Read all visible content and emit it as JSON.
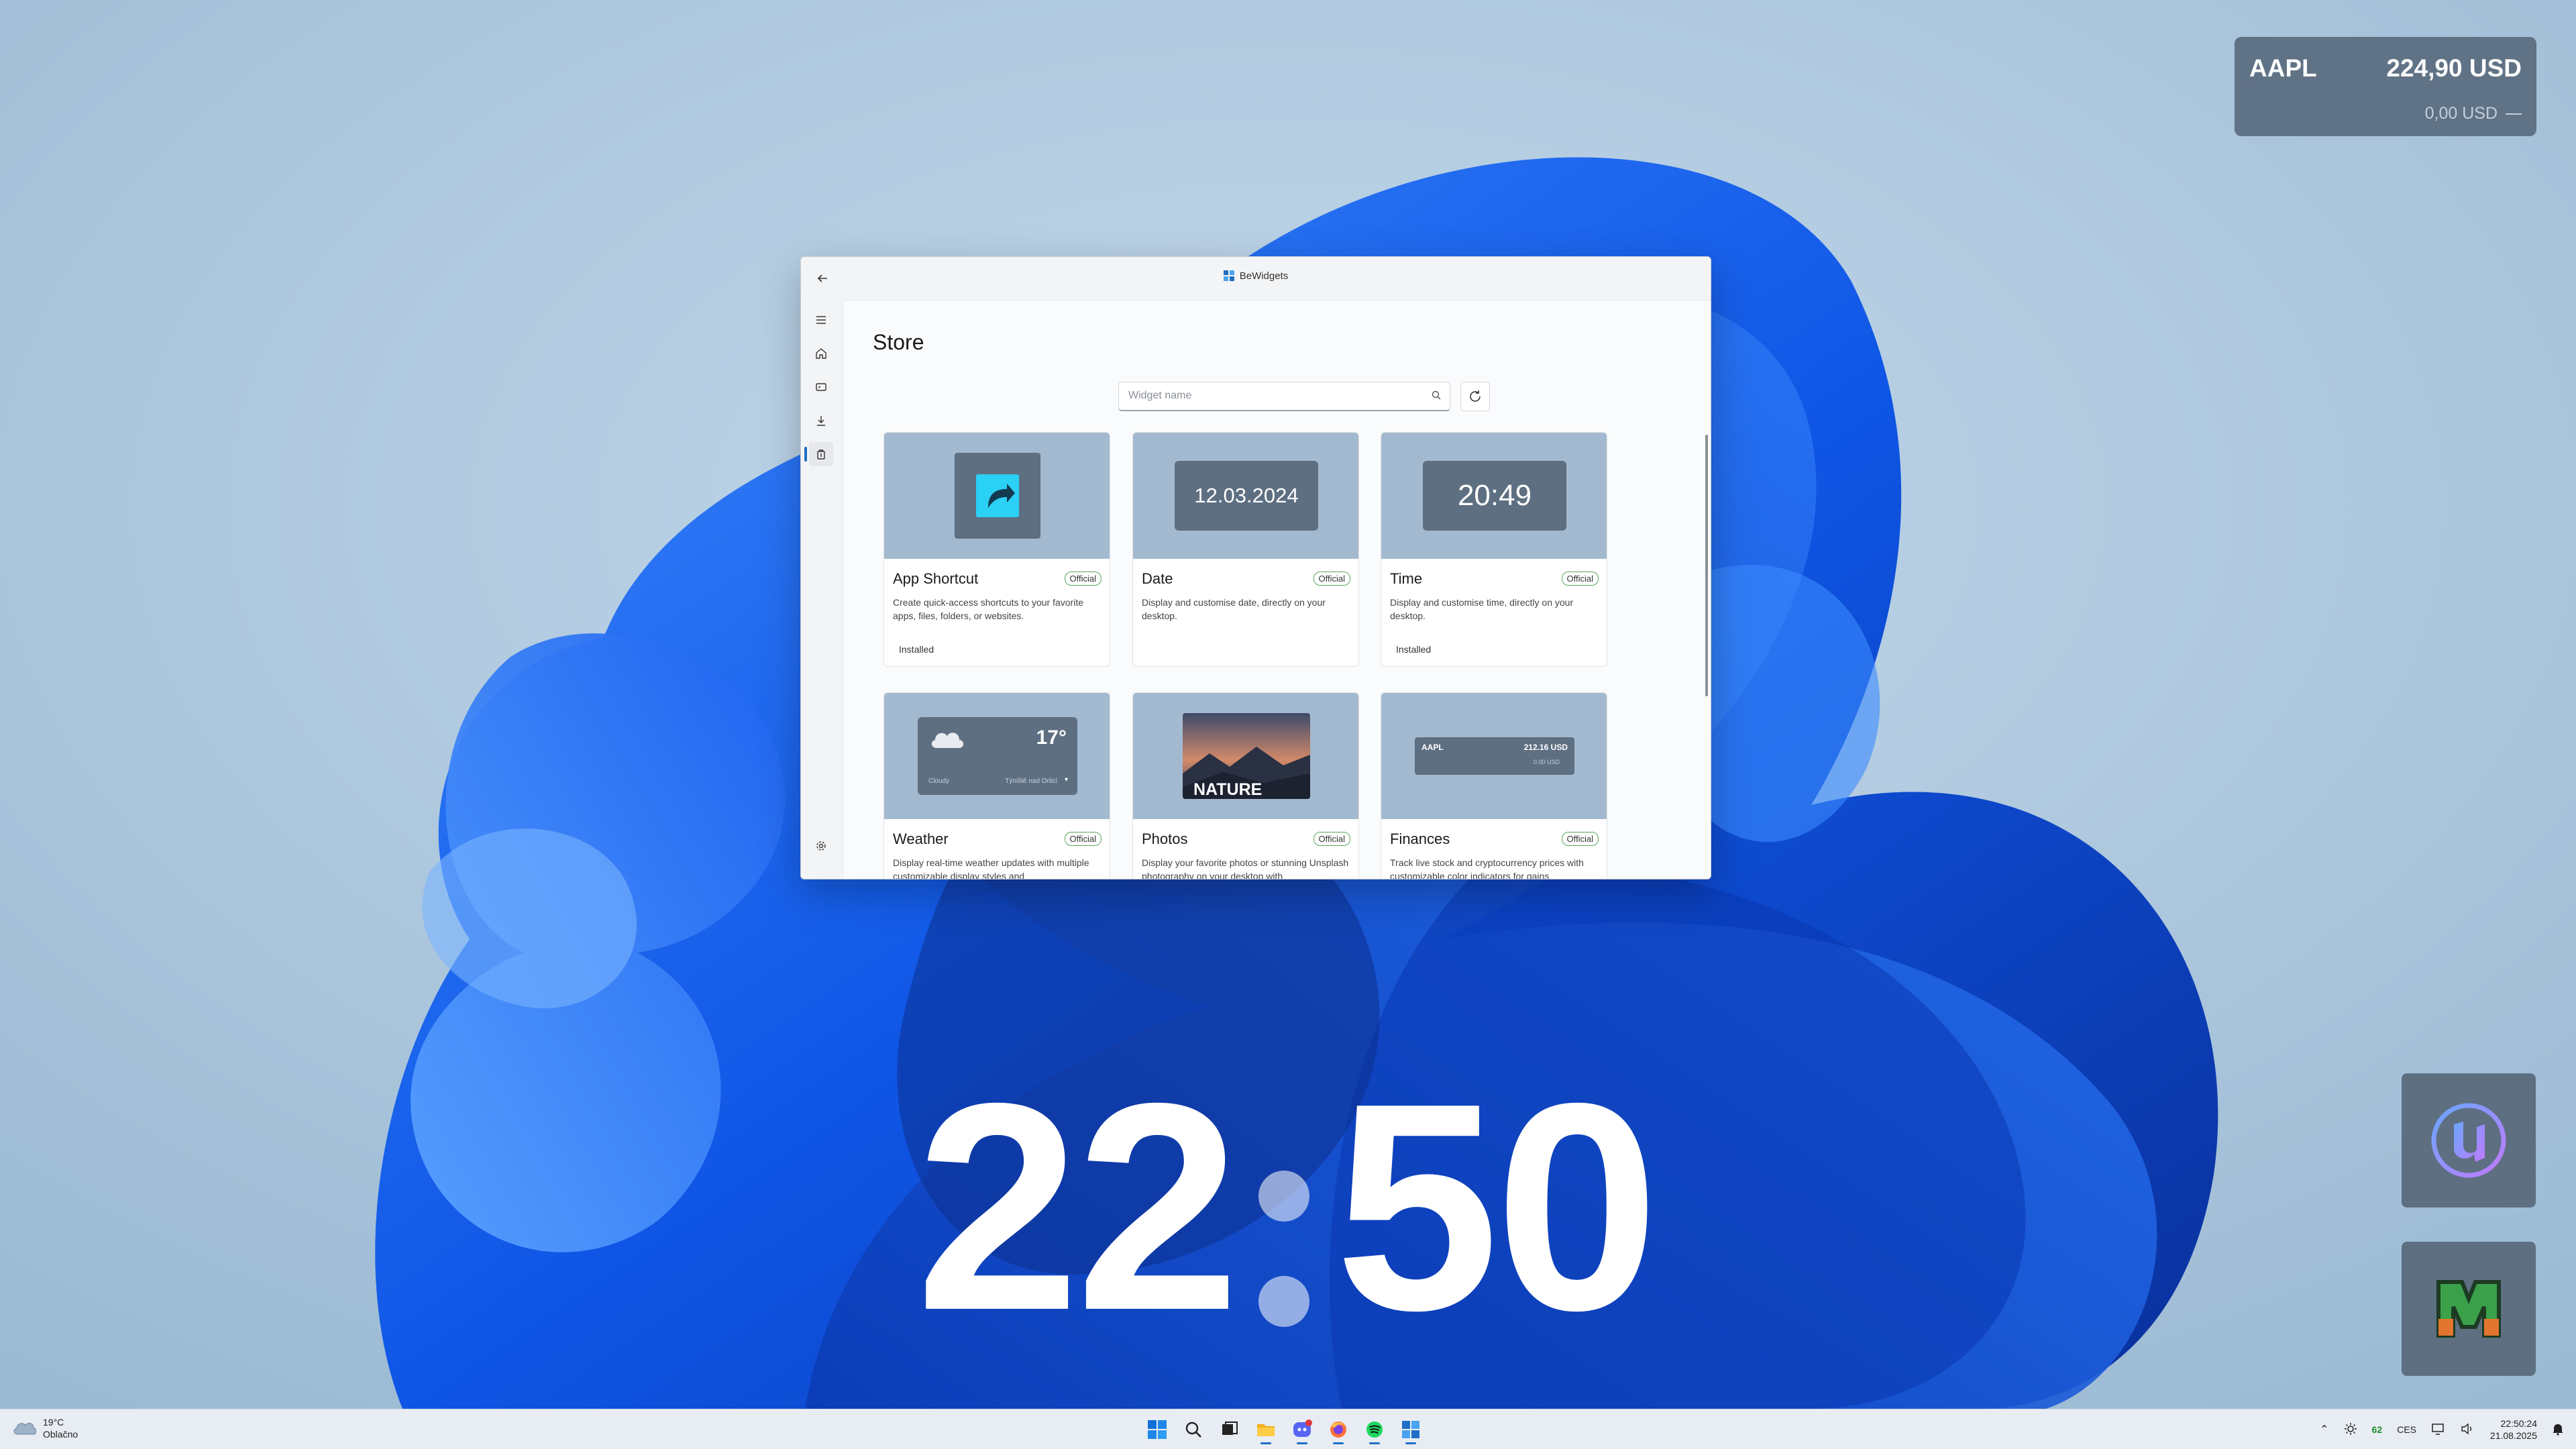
{
  "desktop": {
    "stock_widget": {
      "symbol": "AAPL",
      "price": "224,90 USD",
      "change": "0,00 USD"
    },
    "clock_widget": {
      "hours": "22",
      "minutes": "50"
    },
    "shortcuts": [
      {
        "icon": "unreal-engine-icon"
      },
      {
        "icon": "minecraft-launcher-icon"
      }
    ]
  },
  "window": {
    "app_title": "BeWidgets",
    "nav": [
      {
        "icon": "menu-icon"
      },
      {
        "icon": "home-icon"
      },
      {
        "icon": "widgets-icon"
      },
      {
        "icon": "download-icon"
      },
      {
        "icon": "store-icon",
        "active": true
      }
    ],
    "settings_icon": "gear-icon",
    "page_title": "Store",
    "search": {
      "placeholder": "Widget name",
      "value": ""
    },
    "cards": [
      {
        "name": "App Shortcut",
        "badge": "Official",
        "description": "Create quick-access shortcuts to your favorite apps, files, folders, or websites.",
        "status": "Installed"
      },
      {
        "name": "Date",
        "badge": "Official",
        "description": "Display and customise date, directly on your desktop.",
        "status": "",
        "preview_text": "12.03.2024"
      },
      {
        "name": "Time",
        "badge": "Official",
        "description": "Display and customise time, directly on your desktop.",
        "status": "Installed",
        "preview_text": "20:49"
      },
      {
        "name": "Weather",
        "badge": "Official",
        "description": "Display real-time weather updates with multiple customizable display styles and",
        "status": "",
        "preview_temp": "17°",
        "preview_condition": "Cloudy",
        "preview_location": "Týniště nad Orlicí"
      },
      {
        "name": "Photos",
        "badge": "Official",
        "description": "Display your favorite photos or stunning Unsplash photography on your desktop with",
        "status": "",
        "preview_text": "NATURE"
      },
      {
        "name": "Finances",
        "badge": "Official",
        "description": "Track live stock and cryptocurrency prices with customizable color indicators for gains",
        "status": "",
        "preview_symbol": "AAPL",
        "preview_price": "212.16 USD",
        "preview_change": "0.00 USD"
      }
    ]
  },
  "taskbar": {
    "weather": {
      "temp": "19°C",
      "condition": "Oblačno"
    },
    "apps": [
      {
        "icon": "windows-start-icon",
        "active": false
      },
      {
        "icon": "search-icon",
        "active": false
      },
      {
        "icon": "task-view-icon",
        "active": false
      },
      {
        "icon": "file-explorer-icon",
        "active": true
      },
      {
        "icon": "discord-icon",
        "active": true
      },
      {
        "icon": "firefox-icon",
        "active": true
      },
      {
        "icon": "spotify-icon",
        "active": true
      },
      {
        "icon": "bewidgets-icon",
        "active": true
      }
    ],
    "tray": {
      "brightness": "62",
      "language": "CES",
      "time": "22:50:24",
      "date": "21.08.2025"
    }
  }
}
